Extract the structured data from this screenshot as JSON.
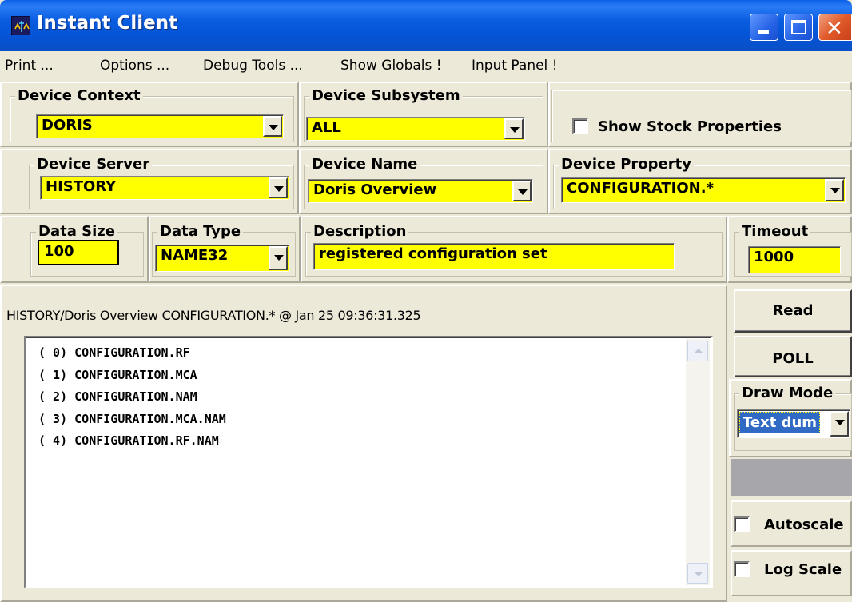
{
  "window": {
    "title": "Instant Client",
    "buttons": {
      "minimize": "minimize",
      "maximize": "maximize",
      "close": "✕"
    }
  },
  "menu": [
    {
      "label": "Print ..."
    },
    {
      "label": "Options ..."
    },
    {
      "label": "Debug Tools ..."
    },
    {
      "label": "Show Globals !"
    },
    {
      "label": "Input Panel !"
    }
  ],
  "device_context": {
    "label": "Device Context",
    "value": "DORIS"
  },
  "device_subsystem": {
    "label": "Device Subsystem",
    "value": "ALL"
  },
  "show_stock": {
    "label": "Show Stock Properties",
    "checked": false
  },
  "device_server": {
    "label": "Device Server",
    "value": "HISTORY"
  },
  "device_name": {
    "label": "Device Name",
    "value": "Doris Overview"
  },
  "device_property": {
    "label": "Device Property",
    "value": "CONFIGURATION.*"
  },
  "data_size": {
    "label": "Data Size",
    "value": "100"
  },
  "data_type": {
    "label": "Data Type",
    "value": "NAME32"
  },
  "description": {
    "label": "Description",
    "value": "registered configuration set"
  },
  "timeout": {
    "label": "Timeout",
    "value": "1000"
  },
  "output": {
    "status": "HISTORY/Doris Overview CONFIGURATION.* @ Jan 25 09:36:31.325",
    "lines": [
      "( 0) CONFIGURATION.RF",
      "( 1) CONFIGURATION.MCA",
      "( 2) CONFIGURATION.NAM",
      "( 3) CONFIGURATION.MCA.NAM",
      "( 4) CONFIGURATION.RF.NAM"
    ]
  },
  "controls": {
    "read": "Read",
    "poll": "POLL",
    "draw_mode": {
      "label": "Draw Mode",
      "value": "Text dum"
    },
    "autoscale": {
      "label": "Autoscale",
      "checked": false
    },
    "log_scale": {
      "label": "Log Scale",
      "checked": false
    }
  },
  "colors": {
    "field_bg": "#ffff00",
    "titlebar": "#0a5de0",
    "face": "#ece9d8",
    "selection": "#316ac5"
  }
}
